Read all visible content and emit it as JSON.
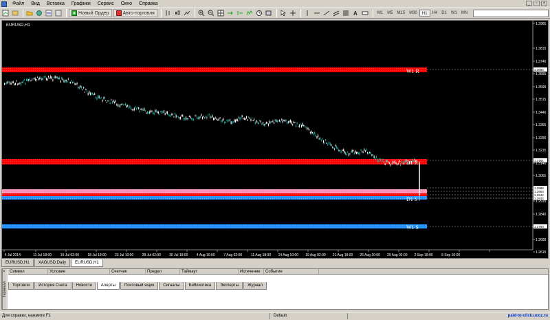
{
  "menu": [
    "Файл",
    "Вид",
    "Вставка",
    "Графики",
    "Сервис",
    "Окно",
    "Справка"
  ],
  "toolbar": {
    "new_order": "Новый Ордер",
    "auto_trading": "Авто-торговля",
    "timeframes": [
      "M1",
      "M5",
      "M15",
      "M30",
      "H1",
      "H4",
      "D1",
      "W1",
      "MN"
    ],
    "active_timeframe": "H1"
  },
  "chart": {
    "title": "EURUSD,H1",
    "price_labels": [
      "1.3965",
      "1.3815",
      "1.3740",
      "1.3665",
      "1.3590",
      "1.3515",
      "1.3440",
      "1.3365",
      "1.3290",
      "1.3215",
      "1.3140",
      "1.3065",
      "1.2990",
      "1.2915",
      "1.2840",
      "1.2765",
      "1.2690",
      "1.2615"
    ],
    "level_price_tags": [
      "1.3694",
      "1.3161",
      "1.2988",
      "1.2963",
      "1.2944",
      "1.2933",
      "1.2790"
    ],
    "date_labels": [
      "4 Jul 2014",
      "11 Jul 18:00",
      "16 Jul 02:00",
      "18 Jul 18:00",
      "23 Jul 10:00",
      "28 Jul 02:00",
      "30 Jul 18:00",
      "4 Aug 10:00",
      "7 Aug 02:00",
      "11 Aug 18:00",
      "14 Aug 10:00",
      "19 Aug 02:00",
      "21 Aug 18:00",
      "26 Aug 10:00",
      "29 Aug 02:00",
      "2 Sep 18:00",
      "5 Sep 10:00"
    ],
    "zone_labels": {
      "w1_r": "W1 R",
      "d1_r": "D1 R",
      "d1_s": "D1 S",
      "w1_s": "W1 S"
    },
    "colors": {
      "background": "#000000",
      "resistance": "#ff0000",
      "support": "#1e90ff",
      "support_pink": "#ff8fb8",
      "candle_up": "#20b2aa",
      "candle_down": "#ffffff"
    }
  },
  "chart_tabs": [
    "EURUSD,H1",
    "XAGUSD,Daily",
    "EURUSD,H1"
  ],
  "active_chart_tab": 2,
  "terminal": {
    "side_label": "Терминал",
    "columns": [
      "Символ",
      "Условие",
      "Счетчик",
      "Предел",
      "Таймаут",
      "Истечение",
      "Событие"
    ],
    "tabs": [
      "Торговля",
      "История Счета",
      "Новости",
      "Алерты",
      "Почтовый ящик",
      "Сигналы",
      "Библиотека",
      "Эксперты",
      "Журнал"
    ],
    "active_tab": "Алерты"
  },
  "status": {
    "help": "Для справки, нажмите F1",
    "profile": "Default",
    "watermark": "paid-to-click.ucoz.ru"
  }
}
